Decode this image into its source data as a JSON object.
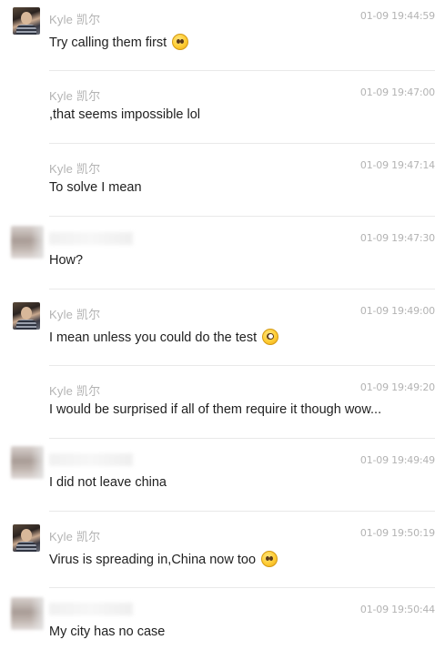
{
  "messages": [
    {
      "sender": "Kyle 凯尔",
      "avatar": "kyle",
      "time": "01-09 19:44:59",
      "text": "Try calling them first",
      "emoji": "pleading-face-icon"
    },
    {
      "sender": "Kyle 凯尔",
      "avatar": "",
      "time": "01-09 19:47:00",
      "text": ",that seems impossible lol",
      "emoji": ""
    },
    {
      "sender": "Kyle 凯尔",
      "avatar": "",
      "time": "01-09 19:47:14",
      "text": "To solve I mean",
      "emoji": ""
    },
    {
      "sender": "",
      "avatar": "blur",
      "time": "01-09 19:47:30",
      "text": "How?",
      "emoji": ""
    },
    {
      "sender": "Kyle 凯尔",
      "avatar": "kyle",
      "time": "01-09 19:49:00",
      "text": "I mean unless you could do the test",
      "emoji": "flushed-face-icon"
    },
    {
      "sender": "Kyle 凯尔",
      "avatar": "",
      "time": "01-09 19:49:20",
      "text": "I would be surprised if all of them require it though wow...",
      "emoji": ""
    },
    {
      "sender": "",
      "avatar": "blur",
      "time": "01-09 19:49:49",
      "text": "I did not leave china",
      "emoji": ""
    },
    {
      "sender": "Kyle 凯尔",
      "avatar": "kyle",
      "time": "01-09 19:50:19",
      "text": "Virus is spreading in,China now too",
      "emoji": "pleading-face-icon"
    },
    {
      "sender": "",
      "avatar": "blur",
      "time": "01-09 19:50:44",
      "text": "My city has no case",
      "emoji": ""
    }
  ]
}
